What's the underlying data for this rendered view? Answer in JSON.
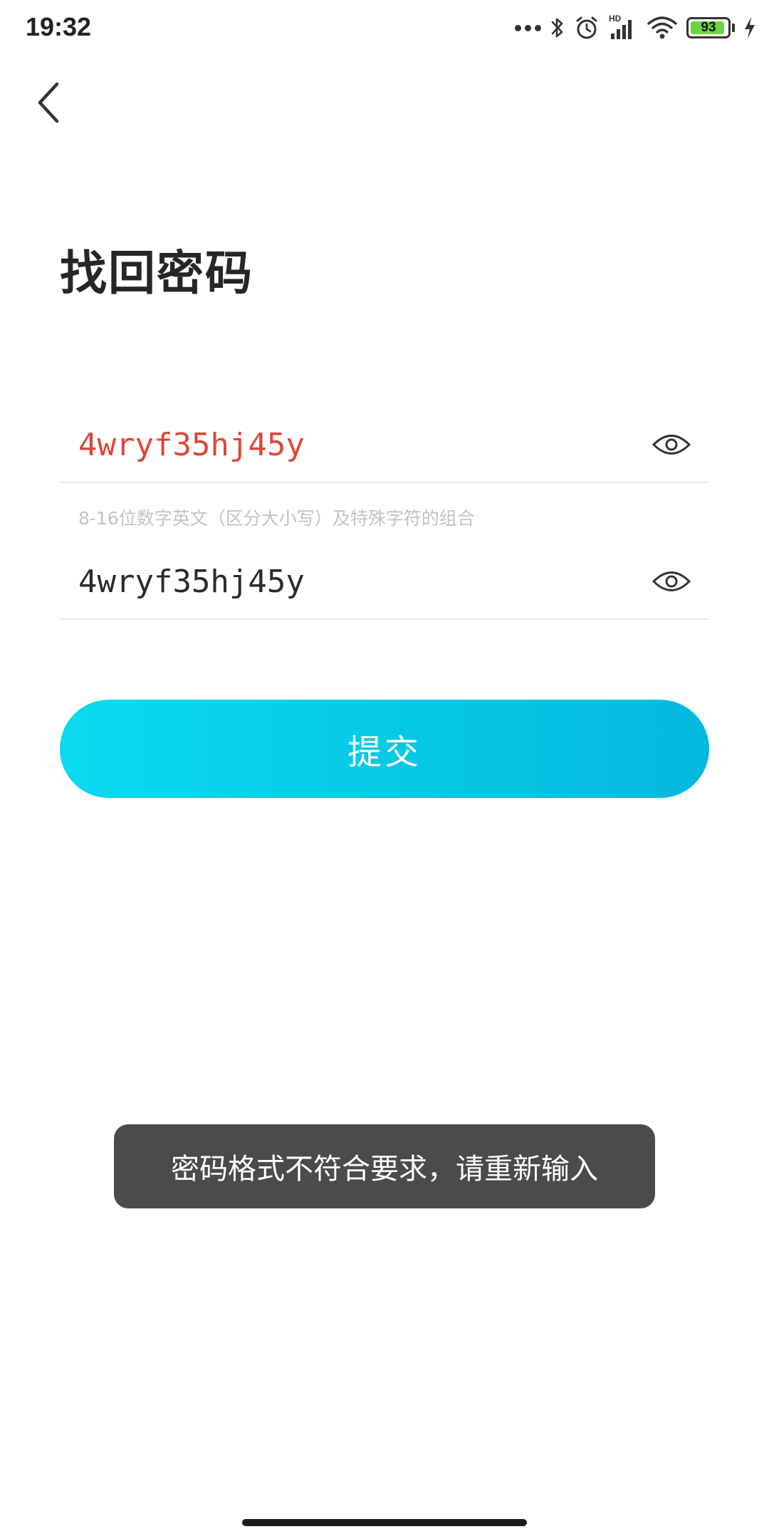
{
  "status_bar": {
    "time": "19:32",
    "hd_label": "HD",
    "battery_level": "93",
    "battery_fraction": 0.93,
    "icons": [
      "more-dots-icon",
      "bluetooth-icon",
      "alarm-icon",
      "signal-icon",
      "wifi-icon",
      "battery-icon",
      "charging-icon"
    ]
  },
  "header": {
    "back_icon": "chevron-left-icon",
    "title": "找回密码"
  },
  "form": {
    "new_password": {
      "value": "4wryf35hj45y",
      "state": "error",
      "toggle_icon": "eye-icon"
    },
    "hint": "8-16位数字英文（区分大小写）及特殊字符的组合",
    "confirm_password": {
      "value": "4wryf35hj45y",
      "toggle_icon": "eye-icon"
    },
    "submit_label": "提交"
  },
  "toast": {
    "message": "密码格式不符合要求，请重新输入"
  },
  "colors": {
    "error_text": "#e0453a",
    "button_gradient_start": "#09dbef",
    "button_gradient_end": "#04b8de",
    "toast_background": "#4b4b4b"
  }
}
